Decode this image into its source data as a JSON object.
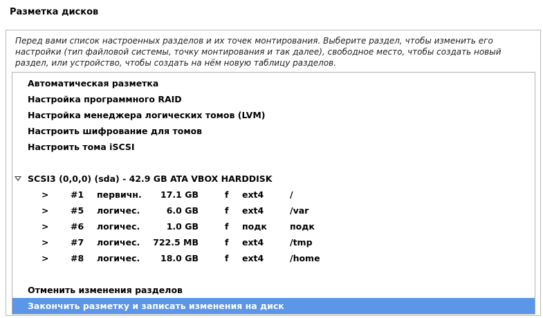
{
  "title": "Разметка дисков",
  "description": "Перед вами список настроенных разделов и их точек монтирования. Выберите раздел, чтобы изменить его настройки (тип файловой системы, точку монтирования и так далее), свободное место, чтобы создать новый раздел, или устройство, чтобы создать на нём новую таблицу разделов.",
  "menu": {
    "auto": "Автоматическая разметка",
    "raid": "Настройка программного RAID",
    "lvm": "Настройка менеджера логических томов (LVM)",
    "crypto": "Настроить шифрование для томов",
    "iscsi": "Настроить тома iSCSI"
  },
  "disk": {
    "label": "SCSI3 (0,0,0) (sda) - 42.9 GB ATA VBOX HARDDISK",
    "partitions": [
      {
        "arrow": ">",
        "num": "#1",
        "type": "первичн.",
        "size": "17.1 GB",
        "flag": "f",
        "fs": "ext4",
        "mount": "/"
      },
      {
        "arrow": ">",
        "num": "#5",
        "type": "логичес.",
        "size": "6.0 GB",
        "flag": "f",
        "fs": "ext4",
        "mount": "/var"
      },
      {
        "arrow": ">",
        "num": "#6",
        "type": "логичес.",
        "size": "1.0 GB",
        "flag": "f",
        "fs": "подк",
        "mount": "подк"
      },
      {
        "arrow": ">",
        "num": "#7",
        "type": "логичес.",
        "size": "722.5 MB",
        "flag": "f",
        "fs": "ext4",
        "mount": "/tmp"
      },
      {
        "arrow": ">",
        "num": "#8",
        "type": "логичес.",
        "size": "18.0 GB",
        "flag": "f",
        "fs": "ext4",
        "mount": "/home"
      }
    ]
  },
  "actions": {
    "undo": "Отменить изменения разделов",
    "finish": "Закончить разметку и записать изменения на диск"
  },
  "colors": {
    "selection": "#5b96e8"
  }
}
